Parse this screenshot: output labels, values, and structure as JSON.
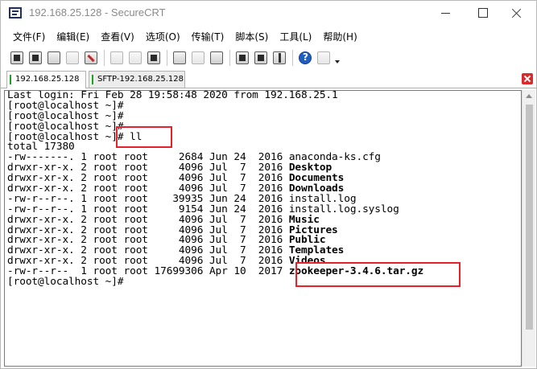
{
  "window": {
    "title": "192.168.25.128 - SecureCRT"
  },
  "menu": {
    "items": [
      "文件(F)",
      "编辑(E)",
      "查看(V)",
      "选项(O)",
      "传输(T)",
      "脚本(S)",
      "工具(L)",
      "帮助(H)"
    ]
  },
  "toolbar": {
    "icons": [
      "connect-icon",
      "quick-connect-icon",
      "connect-tab-icon",
      "reconnect-icon",
      "disconnect-icon",
      "copy-icon",
      "paste-icon",
      "find-icon",
      "print-setup-icon",
      "print-icon",
      "printer-icon",
      "session-options-icon",
      "global-options-icon",
      "keymap-icon",
      "help-icon",
      "options-icon"
    ]
  },
  "tabs": [
    {
      "label": "192.168.25.128",
      "active": true
    },
    {
      "label": "SFTP-192.168.25.128",
      "active": false
    }
  ],
  "terminal": {
    "lines": [
      {
        "text": "Last login: Fri Feb 28 19:58:48 2020 from 192.168.25.1"
      },
      {
        "text": "[root@localhost ~]#"
      },
      {
        "text": "[root@localhost ~]#"
      },
      {
        "text": "[root@localhost ~]#"
      },
      {
        "text": "[root@localhost ~]# ll"
      },
      {
        "text": "total 17380"
      },
      {
        "prefix": "-rw-------. 1 root root     2684 Jun 24  2016 ",
        "name": "anaconda-ks.cfg",
        "bold": false
      },
      {
        "prefix": "drwxr-xr-x. 2 root root     4096 Jul  7  2016 ",
        "name": "Desktop",
        "bold": true
      },
      {
        "prefix": "drwxr-xr-x. 2 root root     4096 Jul  7  2016 ",
        "name": "Documents",
        "bold": true
      },
      {
        "prefix": "drwxr-xr-x. 2 root root     4096 Jul  7  2016 ",
        "name": "Downloads",
        "bold": true
      },
      {
        "prefix": "-rw-r--r--. 1 root root    39935 Jun 24  2016 ",
        "name": "install.log",
        "bold": false
      },
      {
        "prefix": "-rw-r--r--. 1 root root     9154 Jun 24  2016 ",
        "name": "install.log.syslog",
        "bold": false
      },
      {
        "prefix": "drwxr-xr-x. 2 root root     4096 Jul  7  2016 ",
        "name": "Music",
        "bold": true
      },
      {
        "prefix": "drwxr-xr-x. 2 root root     4096 Jul  7  2016 ",
        "name": "Pictures",
        "bold": true
      },
      {
        "prefix": "drwxr-xr-x. 2 root root     4096 Jul  7  2016 ",
        "name": "Public",
        "bold": true
      },
      {
        "prefix": "drwxr-xr-x. 2 root root     4096 Jul  7  2016 ",
        "name": "Templates",
        "bold": true
      },
      {
        "prefix": "drwxr-xr-x. 2 root root     4096 Jul  7  2016 ",
        "name": "Videos",
        "bold": true
      },
      {
        "prefix": "-rw-r--r--  1 root root 17699306 Apr 10  2017 ",
        "name": "zookeeper-3.4.6.tar.gz",
        "bold": true
      },
      {
        "text": "[root@localhost ~]#"
      }
    ]
  },
  "colors": {
    "highlight": "#e8202a",
    "tab_indicator": "#1aa521",
    "close_button": "#d92b2b"
  }
}
